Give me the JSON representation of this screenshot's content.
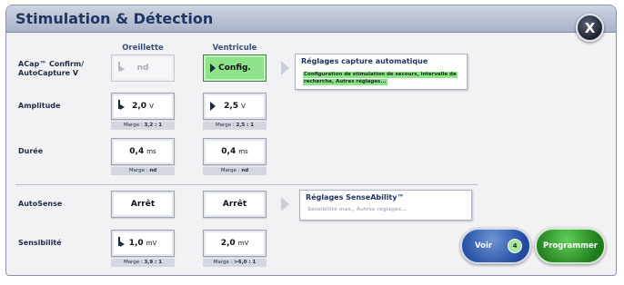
{
  "window": {
    "title": "Stimulation & Détection",
    "close_label": "X"
  },
  "columns": {
    "atrium": "Oreillette",
    "ventricle": "Ventricule"
  },
  "rows": {
    "acap": {
      "label_line1": "ACap™ Confirm/",
      "label_line2": "AutoCapture V"
    },
    "amplitude": {
      "label": "Amplitude"
    },
    "duree": {
      "label": "Durée"
    },
    "autosense": {
      "label": "AutoSense"
    },
    "sensibilite": {
      "label": "Sensibilité"
    }
  },
  "controls": {
    "acap_atrium": {
      "value": "nd"
    },
    "acap_ventricle": {
      "value": "Config."
    },
    "amp_atrium": {
      "value": "2,0",
      "unit": "V",
      "margin_label": "Marge :",
      "margin_value": "3,2 : 1"
    },
    "amp_ventricle": {
      "value": "2,5",
      "unit": "V",
      "margin_label": "Marge :",
      "margin_value": "2,5 : 1"
    },
    "dur_atrium": {
      "value": "0,4",
      "unit": "ms",
      "margin_label": "Marge :",
      "margin_value": "nd"
    },
    "dur_ventricle": {
      "value": "0,4",
      "unit": "ms",
      "margin_label": "Marge :",
      "margin_value": "nd"
    },
    "as_atrium": {
      "value": "Arrêt"
    },
    "as_ventricle": {
      "value": "Arrêt"
    },
    "sens_atrium": {
      "value": "1,0",
      "unit": "mV",
      "margin_label": "Marge :",
      "margin_value": "3,9 : 1"
    },
    "sens_ventricle": {
      "value": "2,0",
      "unit": "mV",
      "margin_label": "Marge :",
      "margin_value": ">6,0 : 1"
    }
  },
  "panels": {
    "capture": {
      "title": "Réglages capture automatique",
      "sub_line1": "Configuration de stimulation de secours, intervalle de",
      "sub_line2": "recherche, Autres réglages..."
    },
    "senseability": {
      "title": "Réglages SenseAbility™",
      "sub_line1": "Sensibilité max., Autres réglages..."
    }
  },
  "footer": {
    "voir_label": "Voir",
    "voir_count": "4",
    "program_label": "Programmer"
  }
}
